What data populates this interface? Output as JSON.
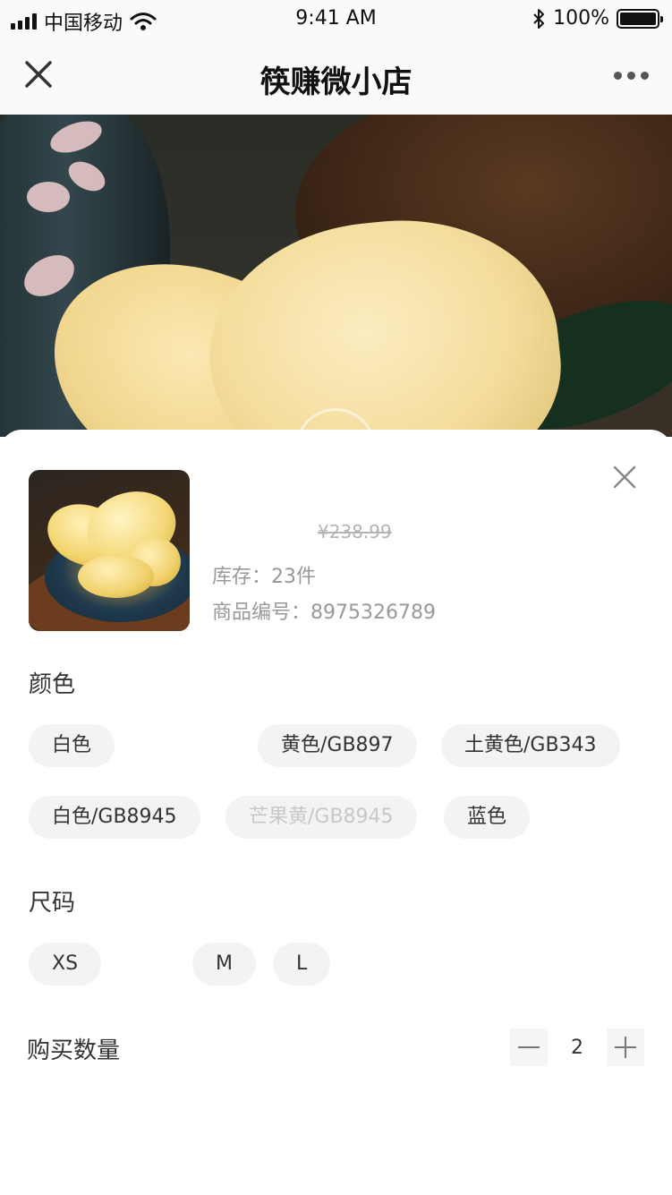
{
  "status_bar": {
    "carrier": "中国移动",
    "time": "9:41 AM",
    "battery": "100%"
  },
  "nav": {
    "title": "筷赚微小店",
    "close_icon": "close-icon",
    "more_icon": "more-dots-icon"
  },
  "product": {
    "original_price": "¥238.99",
    "stock": "库存：23件",
    "sku": "商品编号：8975326789"
  },
  "color_section": {
    "title": "颜色",
    "options": [
      {
        "label": "白色",
        "enabled": true
      },
      {
        "label": "黄色/GB897",
        "enabled": true
      },
      {
        "label": "土黄色/GB343",
        "enabled": true
      },
      {
        "label": "白色/GB8945",
        "enabled": true
      },
      {
        "label": "芒果黄/GB8945",
        "enabled": false
      },
      {
        "label": "蓝色",
        "enabled": true
      }
    ]
  },
  "size_section": {
    "title": "尺码",
    "options": [
      {
        "label": "XS"
      },
      {
        "label": "M"
      },
      {
        "label": "L"
      }
    ]
  },
  "quantity": {
    "label": "购买数量",
    "value": "2"
  },
  "colors": {
    "chip_bg": "#f3f3f3",
    "disabled_text": "#c8c8c8",
    "muted_text": "#999999"
  }
}
